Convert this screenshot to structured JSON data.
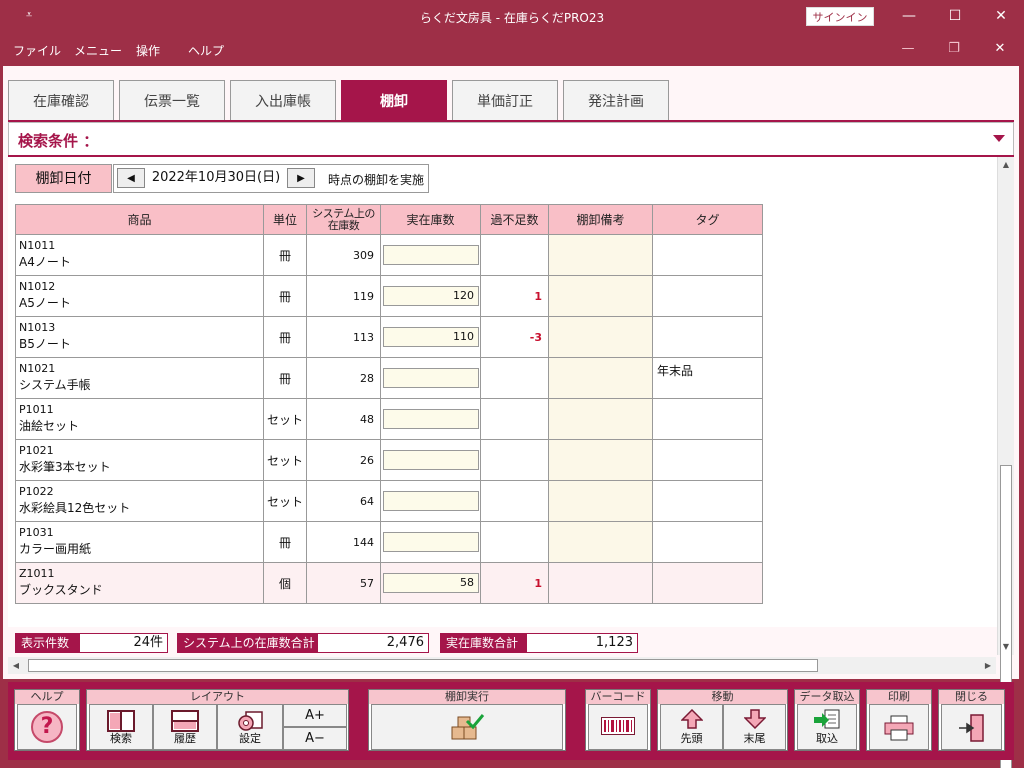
{
  "window": {
    "title": "らくだ文房具 - 在庫らくだPRO23",
    "signin_label": "サインイン",
    "quick_access_symbol": "⩡",
    "minimize_symbol": "—",
    "maximize_symbol": "☐",
    "close_symbol": "✕"
  },
  "menu": {
    "items": [
      "ファイル",
      "メニュー",
      "操作",
      "ヘルプ"
    ],
    "inner_minimize_symbol": "—",
    "inner_restore_symbol": "❐",
    "inner_close_symbol": "✕"
  },
  "tabs": [
    {
      "label": "在庫確認"
    },
    {
      "label": "伝票一覧"
    },
    {
      "label": "入出庫帳"
    },
    {
      "label": "棚卸",
      "active": true
    },
    {
      "label": "単価訂正"
    },
    {
      "label": "発注計画"
    }
  ],
  "search": {
    "label": "検索条件 ："
  },
  "date_row": {
    "label": "棚卸日付",
    "prev_symbol": "◀",
    "next_symbol": "▶",
    "value": "2022年10月30日(日)",
    "suffix": "時点の棚卸を実施"
  },
  "table": {
    "headers": [
      "商品",
      "単位",
      "システム上の在庫数",
      "実在庫数",
      "過不足数",
      "棚卸備考",
      "タグ"
    ],
    "rows": [
      {
        "code": "N1011",
        "name": "A4ノート",
        "unit": "冊",
        "system_qty": "309",
        "actual_qty": "",
        "diff": "",
        "memo": "",
        "tag": ""
      },
      {
        "code": "N1012",
        "name": "A5ノート",
        "unit": "冊",
        "system_qty": "119",
        "actual_qty": "120",
        "diff": "1",
        "memo": "",
        "tag": ""
      },
      {
        "code": "N1013",
        "name": "B5ノート",
        "unit": "冊",
        "system_qty": "113",
        "actual_qty": "110",
        "diff": "-3",
        "memo": "",
        "tag": ""
      },
      {
        "code": "N1021",
        "name": "システム手帳",
        "unit": "冊",
        "system_qty": "28",
        "actual_qty": "",
        "diff": "",
        "memo": "",
        "tag": "年末品"
      },
      {
        "code": "P1011",
        "name": "油絵セット",
        "unit": "セット",
        "system_qty": "48",
        "actual_qty": "",
        "diff": "",
        "memo": "",
        "tag": ""
      },
      {
        "code": "P1021",
        "name": "水彩筆3本セット",
        "unit": "セット",
        "system_qty": "26",
        "actual_qty": "",
        "diff": "",
        "memo": "",
        "tag": ""
      },
      {
        "code": "P1022",
        "name": "水彩絵具12色セット",
        "unit": "セット",
        "system_qty": "64",
        "actual_qty": "",
        "diff": "",
        "memo": "",
        "tag": ""
      },
      {
        "code": "P1031",
        "name": "カラー画用紙",
        "unit": "冊",
        "system_qty": "144",
        "actual_qty": "",
        "diff": "",
        "memo": "",
        "tag": ""
      },
      {
        "code": "Z1011",
        "name": "ブックスタンド",
        "unit": "個",
        "system_qty": "57",
        "actual_qty": "58",
        "diff": "1",
        "memo": "",
        "tag": "",
        "selected": true
      }
    ]
  },
  "totals": {
    "count_label": "表示件数",
    "count_value": "24件",
    "system_total_label": "システム上の在庫数合計",
    "system_total_value": "2,476",
    "actual_total_label": "実在庫数合計",
    "actual_total_value": "1,123"
  },
  "scrollbars": {
    "up": "▲",
    "down": "▼",
    "left": "◀",
    "right": "▶"
  },
  "toolbar": {
    "help": {
      "title": "ヘルプ",
      "glyph": "?"
    },
    "layout": {
      "title": "レイアウト",
      "search": "検索",
      "history": "履歴",
      "settings": "設定",
      "font_up": "A+",
      "font_down": "A−"
    },
    "execute": {
      "title": "棚卸実行"
    },
    "barcode": {
      "title": "バーコード"
    },
    "move": {
      "title": "移動",
      "first": "先頭",
      "last": "末尾"
    },
    "import": {
      "title": "データ取込",
      "label": "取込"
    },
    "print": {
      "title": "印刷"
    },
    "close": {
      "title": "閉じる"
    }
  },
  "colors": {
    "brand": "#9e2f47",
    "accent": "#a5154a",
    "header_pink": "#f9bfc7",
    "negative": "#c8102e"
  }
}
